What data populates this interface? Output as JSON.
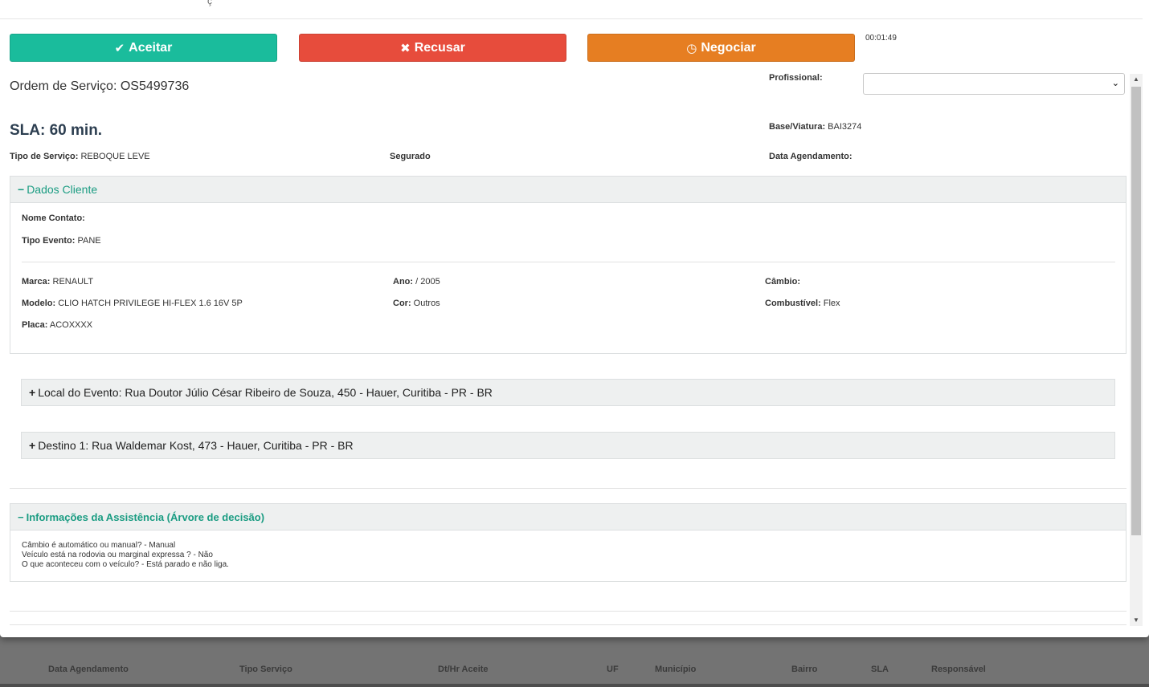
{
  "background_table": {
    "headers": [
      "Data Agendamento",
      "Tipo Serviço",
      "Dt/Hr Aceite",
      "UF",
      "Município",
      "Bairro",
      "SLA",
      "Responsável"
    ]
  },
  "modal": {
    "partial_title": "ç",
    "actions": {
      "accept_label": "Aceitar",
      "refuse_label": "Recusar",
      "negotiate_label": "Negociar"
    },
    "timer": "00:01:49",
    "order_label": "Ordem de Serviço: OS5499736",
    "sla_label": "SLA: 60 min.",
    "professional_label": "Profissional:",
    "professional_value": "",
    "base_label": "Base/Viatura:",
    "base_value": "BAI3274",
    "service_type_label": "Tipo de Serviço:",
    "service_type_value": "REBOQUE LEVE",
    "insured_label": "Segurado",
    "schedule_label": "Data Agendamento:",
    "client_panel": {
      "title": "Dados Cliente",
      "contact_label": "Nome Contato:",
      "event_type_label": "Tipo Evento:",
      "event_type_value": "PANE",
      "brand_label": "Marca:",
      "brand_value": "RENAULT",
      "year_label": "Ano:",
      "year_value": "/ 2005",
      "gearbox_label": "Câmbio:",
      "model_label": "Modelo:",
      "model_value": "CLIO HATCH PRIVILEGE HI-FLEX 1.6 16V 5P",
      "color_label": "Cor:",
      "color_value": "Outros",
      "fuel_label": "Combustível:",
      "fuel_value": "Flex",
      "plate_label": "Placa:",
      "plate_value": "ACOXXXX"
    },
    "event_location": "Local do Evento: Rua Doutor Júlio César Ribeiro de Souza, 450 - Hauer, Curitiba - PR - BR",
    "destination": "Destino 1: Rua Waldemar Kost, 473 - Hauer, Curitiba - PR - BR",
    "assistance_panel": {
      "title": "Informações da Assistência (Árvore de decisão)",
      "lines": [
        "Câmbio é automático ou manual? - Manual",
        "Veículo está na rodovia ou marginal expressa ? - Não",
        "O que aconteceu com o veículo? - Está parado e não liga."
      ]
    }
  },
  "colors": {
    "accept": "#1abc9c",
    "refuse": "#e74c3c",
    "negotiate": "#e67e22",
    "panel_title": "#1a9c82"
  }
}
